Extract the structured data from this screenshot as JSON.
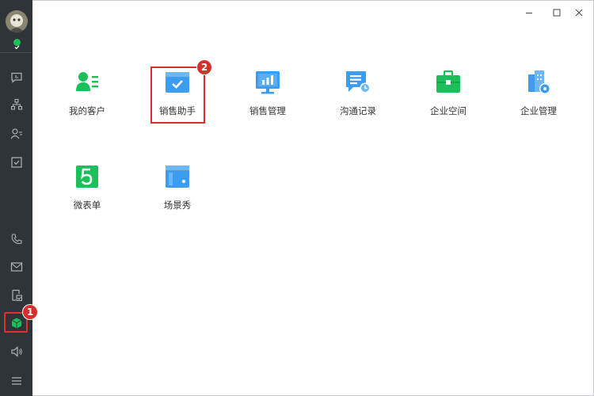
{
  "window": {
    "minimize_icon": "minimize-icon",
    "maximize_icon": "maximize-icon",
    "close_icon": "close-icon"
  },
  "sidebar": {
    "avatar": "user-avatar",
    "status": "online",
    "items": [
      {
        "name": "chat",
        "icon": "chat-icon"
      },
      {
        "name": "organization",
        "icon": "org-chart-icon"
      },
      {
        "name": "contacts",
        "icon": "contacts-icon"
      },
      {
        "name": "tasks",
        "icon": "task-check-icon"
      },
      {
        "name": "phone",
        "icon": "phone-icon"
      },
      {
        "name": "mail",
        "icon": "mail-icon"
      },
      {
        "name": "share",
        "icon": "share-icon"
      },
      {
        "name": "workbench",
        "icon": "cube-icon",
        "active": true
      },
      {
        "name": "notice",
        "icon": "speaker-icon"
      },
      {
        "name": "menu",
        "icon": "menu-icon"
      }
    ]
  },
  "apps": [
    {
      "label": "我的客户",
      "icon": "customer-icon",
      "color": "#1dbf5b"
    },
    {
      "label": "销售助手",
      "icon": "sales-assistant-icon",
      "color": "#3b9cf0"
    },
    {
      "label": "销售管理",
      "icon": "sales-management-icon",
      "color": "#3b9cf0"
    },
    {
      "label": "沟通记录",
      "icon": "communication-record-icon",
      "color": "#3b9cf0"
    },
    {
      "label": "企业空间",
      "icon": "enterprise-space-icon",
      "color": "#1dbf5b"
    },
    {
      "label": "企业管理",
      "icon": "enterprise-management-icon",
      "color": "#3b9cf0"
    },
    {
      "label": "微表单",
      "icon": "micro-form-icon",
      "color": "#1dbf5b"
    },
    {
      "label": "场景秀",
      "icon": "scene-show-icon",
      "color": "#3b9cf0"
    }
  ],
  "annotations": {
    "step1": "1",
    "step2": "2"
  }
}
